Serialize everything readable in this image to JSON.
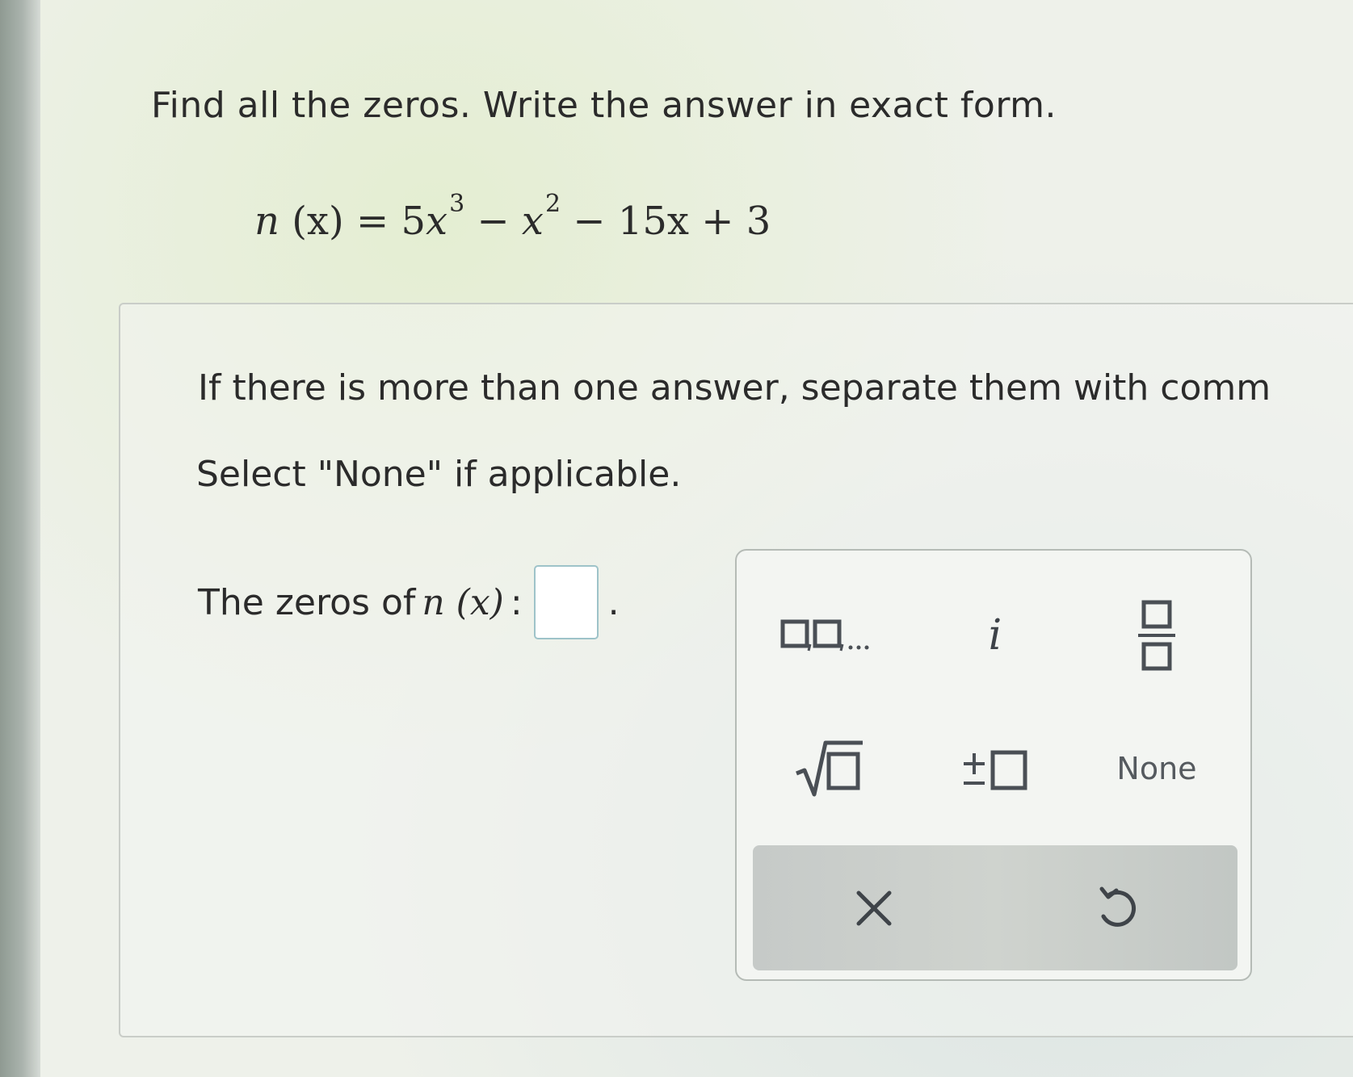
{
  "question": {
    "title": "Find all the zeros. Write the answer in exact form.",
    "equation": {
      "lhs": "n",
      "arg": "(x)",
      "eq": " = 5",
      "term1": "x",
      "exp1": "3",
      "op2": " − ",
      "term2": "x",
      "exp2": "2",
      "rest": " − 15x + 3"
    }
  },
  "instructions": {
    "line1": "If there is more than one answer, separate them with comm",
    "line2": "Select \"None\" if applicable."
  },
  "answer": {
    "prefix": "The zeros of ",
    "fn": "n (x)",
    "colon": ":",
    "value": "",
    "suffix": "."
  },
  "keypad": {
    "keys": {
      "list_icon": "list-separator-icon",
      "imaginary": "i",
      "fraction_icon": "fraction-icon",
      "sqrt_icon": "square-root-icon",
      "plusminus_icon": "plus-minus-icon",
      "none": "None"
    },
    "actions": {
      "clear_icon": "close-icon",
      "undo_icon": "undo-icon"
    }
  },
  "colors": {
    "input_border": "#9ec3c9",
    "icon_color": "#4a4f55",
    "action_bar": "#cacecb"
  }
}
